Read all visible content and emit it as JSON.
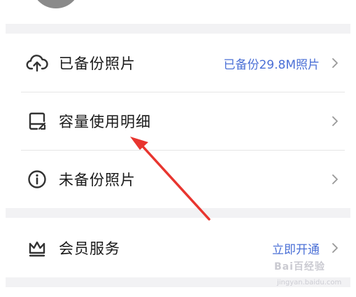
{
  "rows": [
    {
      "label": "已备份照片",
      "value": "已备份29.8M照片",
      "icon": "cloud-upload-icon"
    },
    {
      "label": "容量使用明细",
      "value": "",
      "icon": "storage-detail-icon"
    },
    {
      "label": "未备份照片",
      "value": "",
      "icon": "info-circle-icon"
    },
    {
      "label": "会员服务",
      "value": "立即开通",
      "icon": "crown-icon"
    }
  ],
  "watermark": {
    "brand": "Bai百经验",
    "url": "jingyan.baidu.com"
  },
  "colors": {
    "accent": "#4a6fd6",
    "annotation_arrow": "#e8352f",
    "section_gap": "#f2f2f4"
  }
}
